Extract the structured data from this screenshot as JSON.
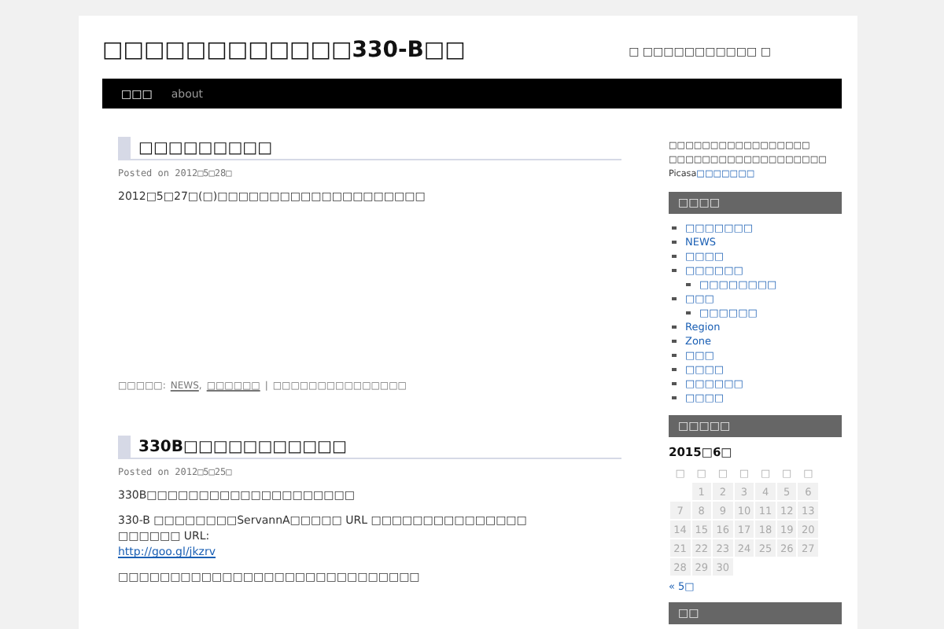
{
  "header": {
    "site_title": "□□□□□□□□□□□□330-B□□",
    "tagline": "□ □□□□□□□□□□□ □"
  },
  "nav": [
    {
      "label": "□□□",
      "selected": true
    },
    {
      "label": "about",
      "selected": false
    }
  ],
  "posts": [
    {
      "title": "□□□□□□□□□",
      "posted_on": "Posted on",
      "date": "2012□5□28□",
      "paragraphs": [
        [
          "2012□5□27□(□)□□□□□□□□□□□□□□□□□□□□"
        ]
      ],
      "meta": {
        "label": "□□□□□:",
        "categories": [
          "NEWS",
          "□□□□□□"
        ],
        "category_separator": ",",
        "separator": "|",
        "comment": "□□□□□□□□□□□□□□□"
      }
    },
    {
      "title": "330B□□□□□□□□□□□",
      "posted_on": "Posted on",
      "date": "2012□5□25□",
      "paragraphs": [
        [
          "330B□□□□□□□□□□□□□□□□□□□□"
        ],
        [
          "330-B □□□□□□□□ServannA□□□□□ URL □□□□□□□□□□□□□□□",
          "□□□□□□ URL:",
          {
            "link": "http://goo.gl/jkzrv"
          }
        ],
        [
          "□□□□□□□□□□□□□□□□□□□□□□□□□□□□□"
        ]
      ]
    }
  ],
  "sidebar": {
    "intro": [
      "□□□□□□□□□□□□□□□□□",
      "□□□□□□□□□□□□□□□□□□□"
    ],
    "intro_link": {
      "prefix": "Picasa",
      "text": "□□□□□□□"
    },
    "categories_title": "□□□□",
    "categories": [
      {
        "label": "□□□□□□□"
      },
      {
        "label": "NEWS"
      },
      {
        "label": "□□□□"
      },
      {
        "label": "□□□□□□",
        "children": [
          {
            "label": "□□□□□□□□"
          }
        ]
      },
      {
        "label": "□□□",
        "children": [
          {
            "label": "□□□□□□"
          }
        ]
      },
      {
        "label": "Region"
      },
      {
        "label": "Zone"
      },
      {
        "label": "□□□"
      },
      {
        "label": "□□□□"
      },
      {
        "label": "□□□□□□"
      },
      {
        "label": "□□□□"
      }
    ],
    "calendar_title": "□□□□□",
    "calendar": {
      "caption": "2015□6□",
      "weekdays": [
        "□",
        "□",
        "□",
        "□",
        "□",
        "□",
        "□"
      ],
      "weeks": [
        {
          "kind": "first",
          "days": [
            "1",
            "2",
            "3",
            "4",
            "5",
            "6"
          ]
        },
        {
          "kind": "full",
          "days": [
            "7",
            "8",
            "9",
            "10",
            "11",
            "12",
            "13"
          ]
        },
        {
          "kind": "full",
          "days": [
            "14",
            "15",
            "16",
            "17",
            "18",
            "19",
            "20"
          ]
        },
        {
          "kind": "full",
          "days": [
            "21",
            "22",
            "23",
            "24",
            "25",
            "26",
            "27"
          ]
        },
        {
          "kind": "last",
          "days": [
            "28",
            "29",
            "30"
          ]
        }
      ],
      "prev": "« 5□"
    },
    "last_widget_title": "□□"
  }
}
